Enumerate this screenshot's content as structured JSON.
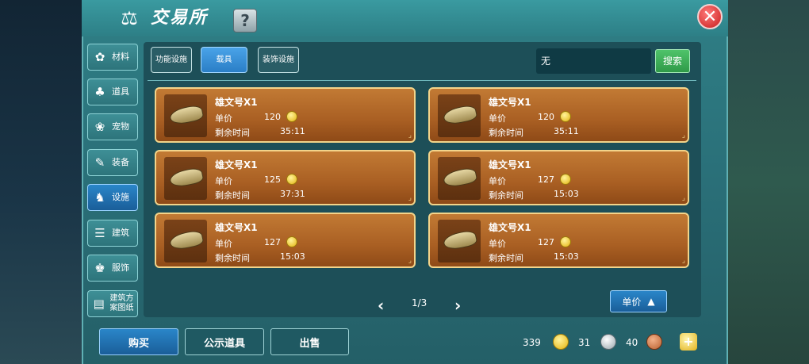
{
  "window": {
    "title": "交易所",
    "help_label": "?",
    "close_label": "✕"
  },
  "sidebar": {
    "items": [
      {
        "label": "材料",
        "icon": "materials-icon",
        "glyph": "✿"
      },
      {
        "label": "道具",
        "icon": "potion-icon",
        "glyph": "♣"
      },
      {
        "label": "宠物",
        "icon": "paw-icon",
        "glyph": "❀"
      },
      {
        "label": "装备",
        "icon": "equipment-icon",
        "glyph": "✎"
      },
      {
        "label": "设施",
        "icon": "horse-icon",
        "glyph": "♞",
        "active": true
      },
      {
        "label": "建筑",
        "icon": "building-icon",
        "glyph": "☰"
      },
      {
        "label": "服饰",
        "icon": "clothing-icon",
        "glyph": "♚"
      },
      {
        "label": "建筑方案图纸",
        "icon": "blueprint-icon",
        "glyph": "▤"
      }
    ]
  },
  "tabs": [
    {
      "label": "功能设施"
    },
    {
      "label": "载具",
      "active": true
    },
    {
      "label": "装饰设施"
    }
  ],
  "search": {
    "value": "无",
    "button_label": "搜索"
  },
  "listings": [
    {
      "name": "雄文号X1",
      "price_label": "单价",
      "price": "120",
      "time_label": "剩余时间",
      "time": "35:11"
    },
    {
      "name": "雄文号X1",
      "price_label": "单价",
      "price": "120",
      "time_label": "剩余时间",
      "time": "35:11"
    },
    {
      "name": "雄文号X1",
      "price_label": "单价",
      "price": "125",
      "time_label": "剩余时间",
      "time": "37:31"
    },
    {
      "name": "雄文号X1",
      "price_label": "单价",
      "price": "127",
      "time_label": "剩余时间",
      "time": "15:03"
    },
    {
      "name": "雄文号X1",
      "price_label": "单价",
      "price": "127",
      "time_label": "剩余时间",
      "time": "15:03"
    },
    {
      "name": "雄文号X1",
      "price_label": "单价",
      "price": "127",
      "time_label": "剩余时间",
      "time": "15:03"
    }
  ],
  "pager": {
    "prev": "‹",
    "next": "›",
    "label": "1/3"
  },
  "sort": {
    "label": "单价"
  },
  "bottom": {
    "buy": "购买",
    "public": "公示道具",
    "sell": "出售"
  },
  "currency": {
    "gold": "339",
    "silver": "31",
    "copper": "40"
  },
  "colors": {
    "panel": "#2a6f78",
    "active_blue": "#2a86c9",
    "card": "#a95f23",
    "card_border": "#f3d48a",
    "search_green": "#3aa955",
    "close_red": "#c81d1d"
  }
}
